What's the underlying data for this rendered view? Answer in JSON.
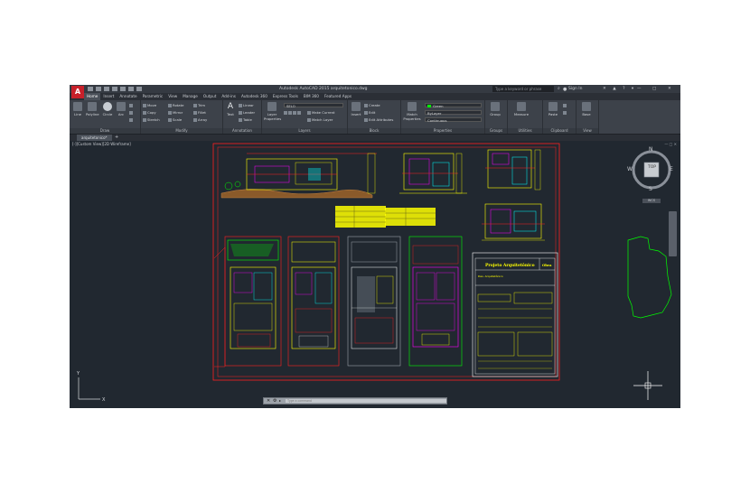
{
  "window": {
    "title": "Autodesk AutoCAD 2015   arquitetonico.dwg",
    "search_placeholder": "Type a keyword or phrase",
    "sign_in": "Sign In",
    "min": "—",
    "max": "□",
    "close": "✕"
  },
  "tabs": [
    {
      "label": "Home",
      "active": true
    },
    {
      "label": "Insert"
    },
    {
      "label": "Annotate"
    },
    {
      "label": "Parametric"
    },
    {
      "label": "View"
    },
    {
      "label": "Manage"
    },
    {
      "label": "Output"
    },
    {
      "label": "Add-ins"
    },
    {
      "label": "Autodesk 360"
    },
    {
      "label": "Express Tools"
    },
    {
      "label": "BIM 360"
    },
    {
      "label": "Featured Apps"
    }
  ],
  "ribbon": {
    "draw": {
      "title": "Draw",
      "line": "Line",
      "polyline": "Polyline",
      "circle": "Circle",
      "arc": "Arc"
    },
    "modify": {
      "title": "Modify",
      "move": "Move",
      "rotate": "Rotate",
      "trim": "Trim",
      "copy": "Copy",
      "mirror": "Mirror",
      "fillet": "Fillet",
      "stretch": "Stretch",
      "scale": "Scale",
      "array": "Array"
    },
    "annotation": {
      "title": "Annotation",
      "text": "Text",
      "linear": "Linear",
      "leader": "Leader",
      "table": "Table"
    },
    "layers": {
      "title": "Layers",
      "layer_properties": "Layer Properties",
      "current_layer": "SELO",
      "make_current": "Make Current",
      "match_layer": "Match Layer"
    },
    "block": {
      "title": "Block",
      "insert": "Insert",
      "create": "Create",
      "edit": "Edit",
      "edit_attributes": "Edit Attributes"
    },
    "properties": {
      "title": "Properties",
      "match_properties": "Match Properties",
      "color": "Green",
      "lineweight": "ByLayer",
      "linetype": "Continuous"
    },
    "groups": {
      "title": "Groups",
      "group": "Group"
    },
    "utilities": {
      "title": "Utilities",
      "measure": "Measure"
    },
    "clipboard": {
      "title": "Clipboard",
      "paste": "Paste"
    },
    "view": {
      "title": "View",
      "base": "Base"
    }
  },
  "file_tab": {
    "name": "arquitetonico*",
    "add": "+"
  },
  "viewport": {
    "label": "[-][Custom View][2D Wireframe]",
    "viewcube": {
      "top": "TOP",
      "n": "N",
      "s": "S",
      "e": "E",
      "w": "W"
    },
    "wcs": "WCS"
  },
  "drawing": {
    "title_block_heading": "Projeto Arquitetônico",
    "title_block_tag": "Obra",
    "title_block_sub": "Des. Arquitetônico"
  },
  "command_line": {
    "placeholder": "Type a command"
  },
  "colors": {
    "viewport_bg": "#212830",
    "ribbon_bg": "#3d424a",
    "titlebar_bg": "#353a42",
    "layer_yellow": "#ffff00",
    "layer_red": "#ff2020",
    "layer_green": "#00ff00",
    "layer_magenta": "#ff00ff",
    "layer_cyan": "#00ffff"
  }
}
